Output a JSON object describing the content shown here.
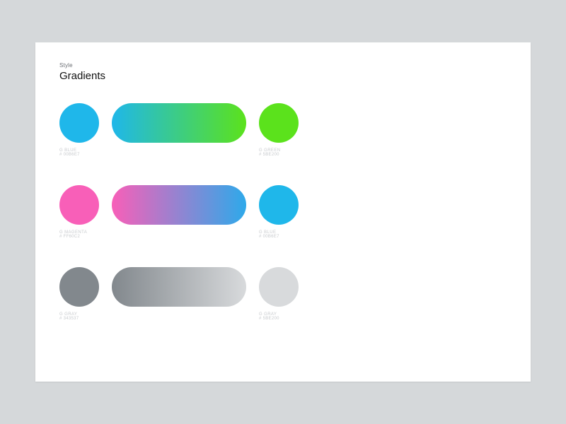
{
  "header": {
    "eyebrow": "Style",
    "title": "Gradients"
  },
  "rows": [
    {
      "left": {
        "name": "G BLUE",
        "hex": "# 00B6E7",
        "color": "#1fb7ea"
      },
      "grad": {
        "from": "#1fb7ea",
        "to": "#5be21c"
      },
      "right": {
        "name": "G GREEN",
        "hex": "# 5BE200",
        "color": "#5be21c"
      }
    },
    {
      "left": {
        "name": "G MAGENTA",
        "hex": "# FF60C2",
        "color": "#f85fb8"
      },
      "grad": {
        "from": "#f85fb8",
        "to": "#2ea9ea"
      },
      "right": {
        "name": "G BLUE",
        "hex": "# 00B6E7",
        "color": "#1fb7ea"
      }
    },
    {
      "left": {
        "name": "G GRAY",
        "hex": "# 343537",
        "color": "#82888d"
      },
      "grad": {
        "from": "#82888d",
        "to": "#d8dadc"
      },
      "right": {
        "name": "G GRAY",
        "hex": "# 5BE200",
        "color": "#d8dadc"
      }
    }
  ]
}
